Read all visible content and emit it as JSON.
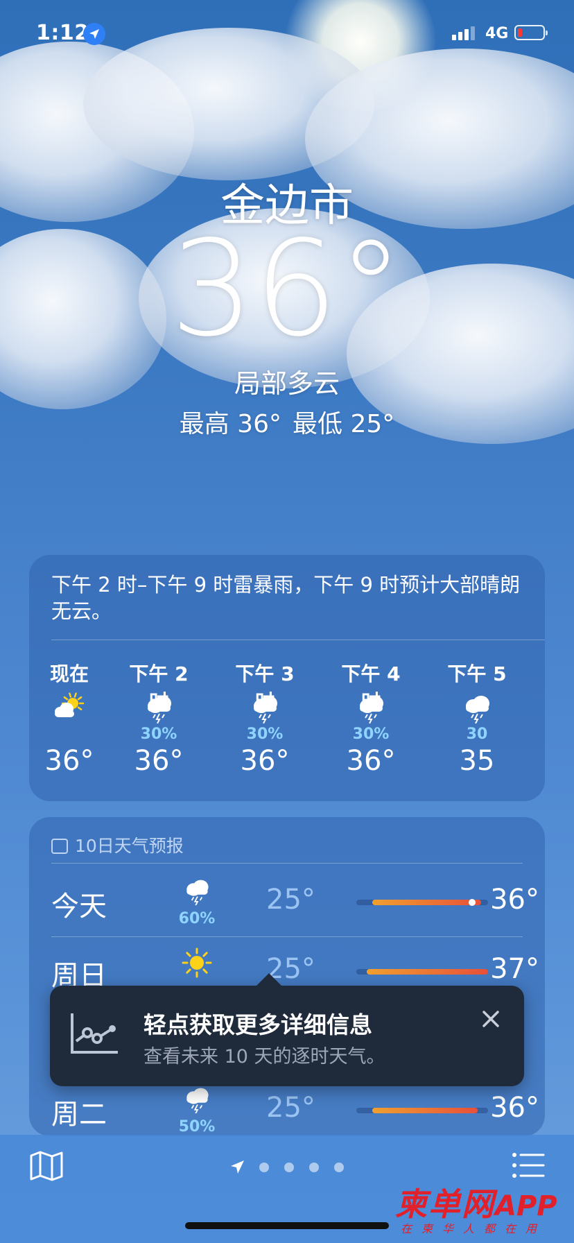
{
  "status": {
    "time": "1:12",
    "network": "4G"
  },
  "location": {
    "city": "金边市",
    "temperature": "36°",
    "condition": "局部多云",
    "high": "最高 36°",
    "low": "最低 25°"
  },
  "hourly": {
    "summary": "下午 2 时–下午 9 时雷暴雨，下午 9 时预计大部晴朗无云。",
    "items": [
      {
        "label": "现在",
        "icon": "partly-cloudy-icon",
        "precip": "",
        "temp": "36°"
      },
      {
        "label": "下午 2 时",
        "icon": "thunderstorm-icon",
        "precip": "30%",
        "temp": "36°"
      },
      {
        "label": "下午 3 时",
        "icon": "thunderstorm-icon",
        "precip": "30%",
        "temp": "36°"
      },
      {
        "label": "下午 4 时",
        "icon": "thunderstorm-icon",
        "precip": "30%",
        "temp": "36°"
      },
      {
        "label": "下午 5",
        "icon": "thunderstorm-icon",
        "precip": "30",
        "temp": "35"
      }
    ]
  },
  "daily": {
    "header": "10日天气预报",
    "rows": [
      {
        "day": "今天",
        "icon": "thunderstorm-icon",
        "precip": "60%",
        "low": "25°",
        "high": "36°",
        "range_start": 0.12,
        "range_end": 0.95,
        "current_marker": 0.88
      },
      {
        "day": "周日",
        "icon": "sun-icon",
        "precip": "",
        "low": "25°",
        "high": "37°",
        "range_start": 0.08,
        "range_end": 1.0
      },
      {
        "day": "周二",
        "icon": "thunderstorm-icon",
        "precip": "50%",
        "low": "25°",
        "high": "36°",
        "range_start": 0.12,
        "range_end": 0.92
      }
    ]
  },
  "tooltip": {
    "title": "轻点获取更多详细信息",
    "subtitle": "查看未来 10 天的逐时天气。"
  },
  "tabbar": {
    "pages": 4
  },
  "watermark": {
    "brand": "柬单网",
    "app": "APP",
    "slogan": "在柬华人都在用"
  },
  "colors": {
    "precip": "#8fd4ff",
    "bar_start": "#f0a030",
    "bar_end": "#e8503a"
  }
}
